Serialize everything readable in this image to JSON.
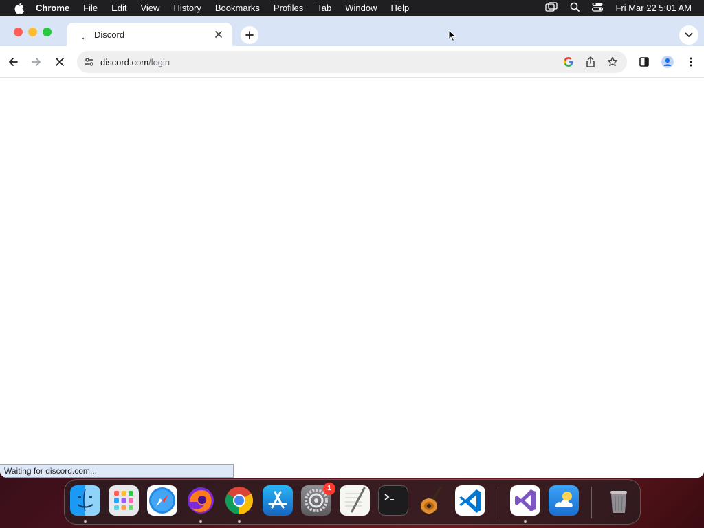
{
  "menubar": {
    "app_name": "Chrome",
    "items": [
      "File",
      "Edit",
      "View",
      "History",
      "Bookmarks",
      "Profiles",
      "Tab",
      "Window",
      "Help"
    ],
    "clock": "Fri Mar 22  5:01 AM"
  },
  "tab": {
    "title": "Discord"
  },
  "omnibox": {
    "domain": "discord.com",
    "path": "/login"
  },
  "status": {
    "text": "Waiting for discord.com..."
  },
  "dock": {
    "apps": [
      "Finder",
      "Launchpad",
      "Safari",
      "Firefox",
      "Chrome",
      "App Store",
      "System Settings",
      "TextEdit",
      "Terminal",
      "GarageBand",
      "Visual Studio Code",
      "Visual Studio",
      "Weather",
      "Trash"
    ],
    "settings_badge": "1"
  },
  "colors": {
    "tabbar_bg": "#d9e5f6",
    "close_light": "#fe5f57",
    "minimize_light": "#febc2e",
    "maximize_light": "#28c840"
  }
}
